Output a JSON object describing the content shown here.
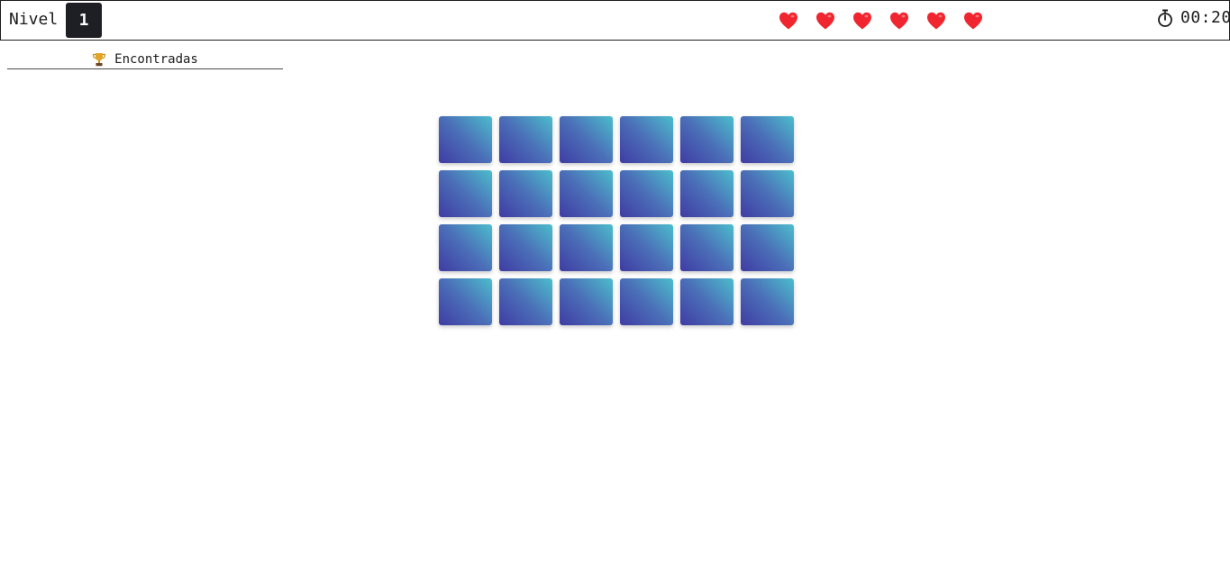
{
  "header": {
    "level_label": "Nivel",
    "level_value": "1",
    "lives": [
      {
        "icon": "heart-icon"
      },
      {
        "icon": "heart-icon"
      },
      {
        "icon": "heart-icon"
      },
      {
        "icon": "heart-icon"
      },
      {
        "icon": "heart-icon"
      },
      {
        "icon": "heart-icon"
      }
    ],
    "timer_icon": "stopwatch-icon",
    "timer_value": "00:20"
  },
  "found": {
    "icon": "trophy-icon",
    "label": "Encontradas"
  },
  "board": {
    "rows": 4,
    "columns": 6,
    "cards_face_down": 24
  },
  "colors": {
    "heart": "#f0252f",
    "level_badge_bg": "#1e1f24",
    "card_gradient_start": "#3f3ca3",
    "card_gradient_end": "#4bbdcc",
    "trophy": "#c8901e"
  }
}
